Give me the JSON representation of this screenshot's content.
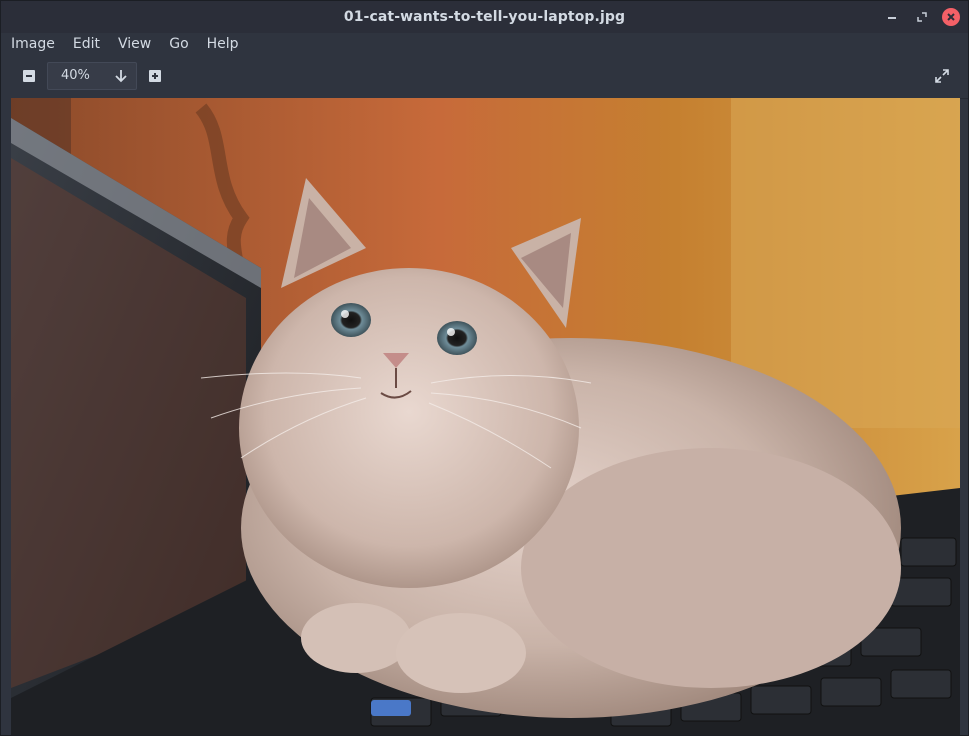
{
  "window": {
    "title": "01-cat-wants-to-tell-you-laptop.jpg"
  },
  "menu": {
    "items": [
      "Image",
      "Edit",
      "View",
      "Go",
      "Help"
    ]
  },
  "toolbar": {
    "zoom_value": "40%"
  },
  "icons": {
    "minimize": "minimize-icon",
    "maximize": "maximize-icon",
    "close": "close-icon",
    "zoom_out": "zoom-out-icon",
    "zoom_in": "zoom-in-icon",
    "dropdown": "arrow-down-icon",
    "fullscreen": "fullscreen-icon"
  },
  "colors": {
    "titlebar": "#2b2e39",
    "chrome": "#2f343f",
    "text": "#d3dae3",
    "close_button": "#f46067"
  }
}
